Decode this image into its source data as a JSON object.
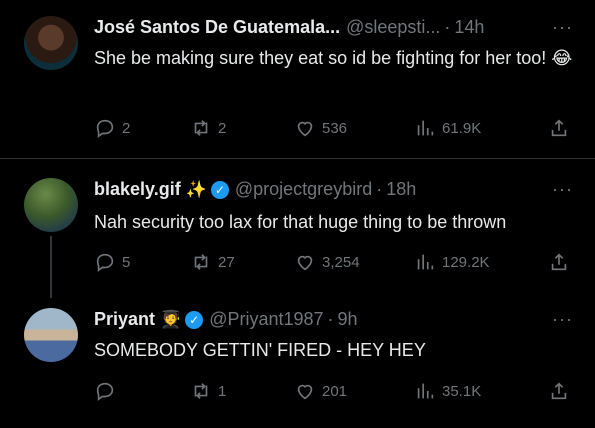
{
  "tweets": [
    {
      "name": "José Santos De Guatemala...",
      "handle": "@sleepsti...",
      "time": "14h",
      "text": "She be making sure they eat so id be fighting for her too! 😂",
      "replies": "2",
      "retweets": "2",
      "likes": "536",
      "views": "61.9K"
    },
    {
      "name": "blakely.gif",
      "name_emoji": "✨",
      "handle": "@projectgreybird",
      "time": "18h",
      "text": "Nah security too lax for that huge thing to be thrown",
      "replies": "5",
      "retweets": "27",
      "likes": "3,254",
      "views": "129.2K"
    },
    {
      "name": "Priyant",
      "name_emoji": "🧑‍🎓",
      "handle": "@Priyant1987",
      "time": "9h",
      "text": "SOMEBODY GETTIN' FIRED - HEY HEY",
      "replies": "",
      "retweets": "1",
      "likes": "201",
      "views": "35.1K"
    }
  ],
  "icons": {
    "more": "more-horizontal-icon",
    "verified": "verified-badge-icon",
    "reply": "reply-icon",
    "retweet": "retweet-icon",
    "like": "heart-icon",
    "views": "views-bar-chart-icon",
    "share": "share-icon"
  },
  "colors": {
    "background": "#000000",
    "text": "#e7e9ea",
    "muted": "#71767b",
    "verified": "#1d9bf0"
  }
}
